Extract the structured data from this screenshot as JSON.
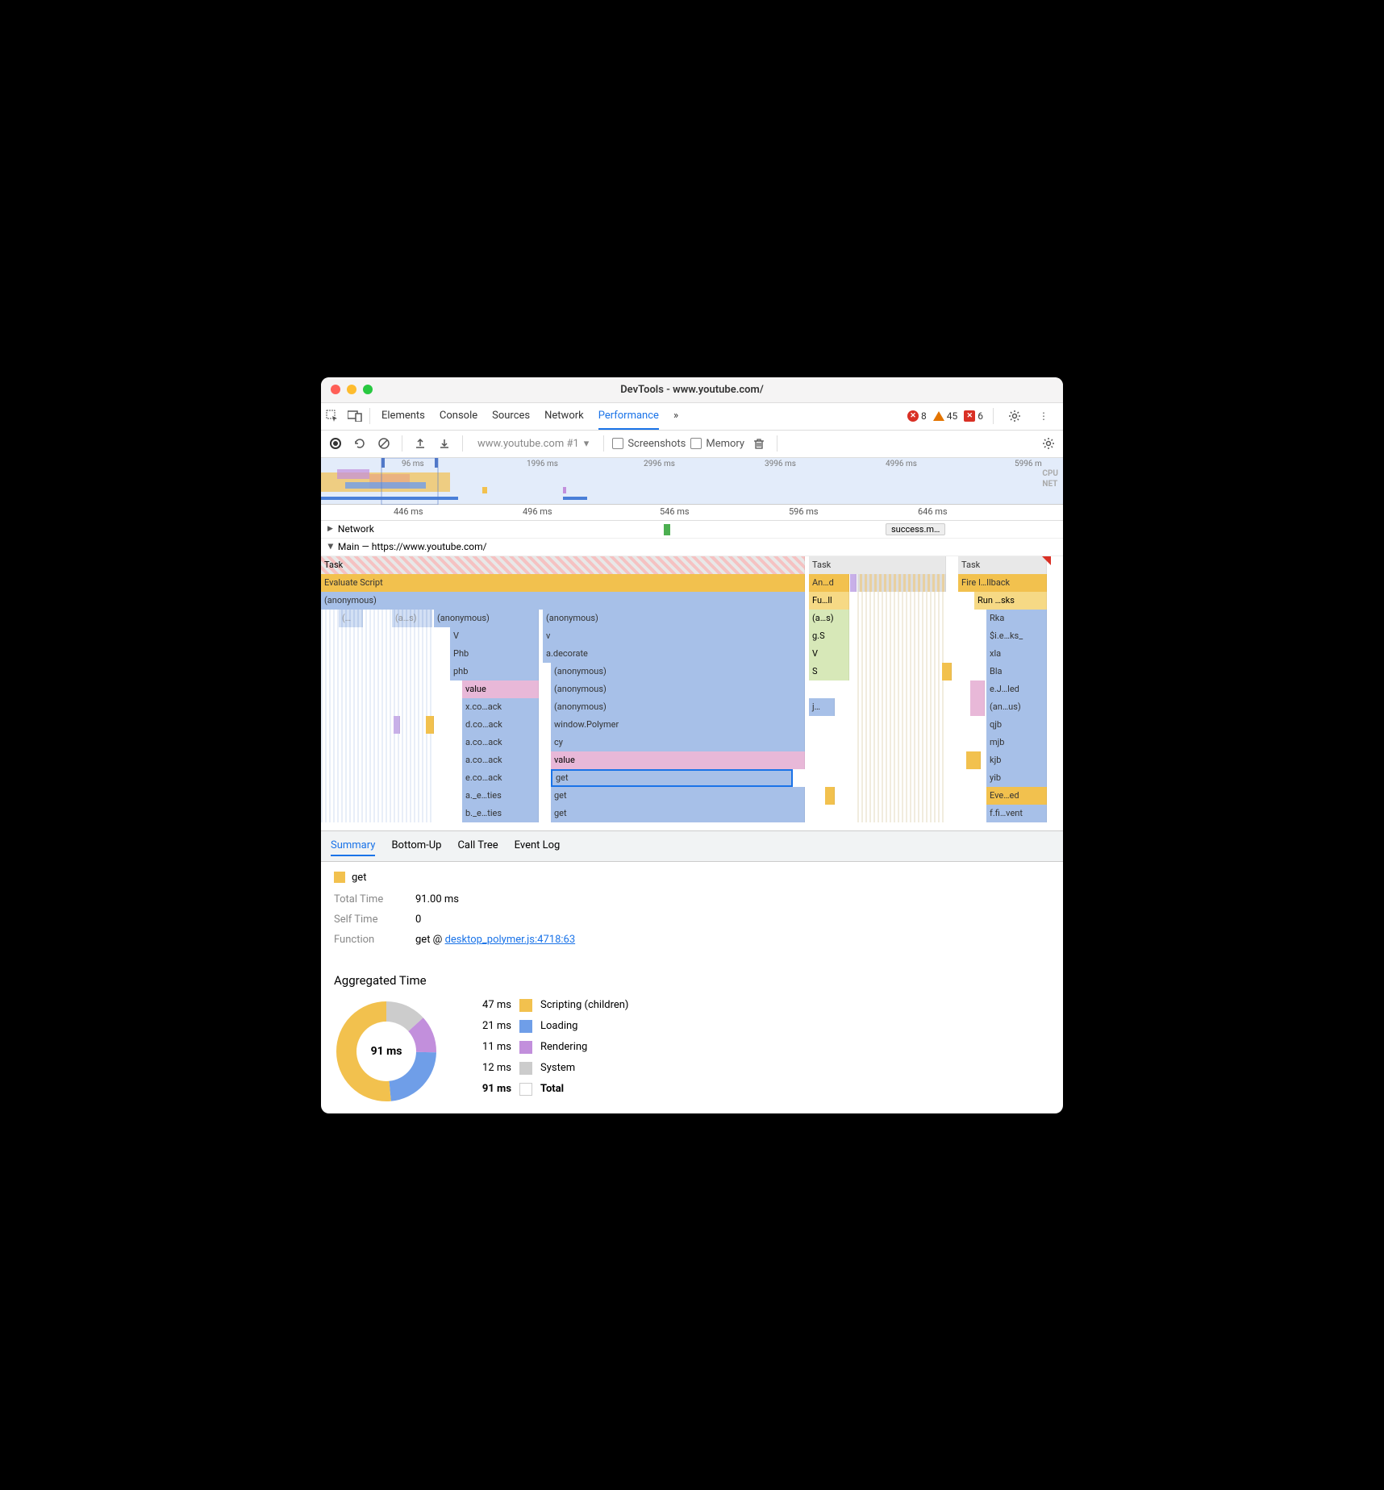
{
  "window": {
    "title": "DevTools - www.youtube.com/"
  },
  "mainTabs": {
    "elements": "Elements",
    "console": "Console",
    "sources": "Sources",
    "network": "Network",
    "performance": "Performance"
  },
  "statusBadges": {
    "errors": "8",
    "warnings": "45",
    "contentErrors": "6"
  },
  "perfToolbar": {
    "url": "www.youtube.com #1",
    "screenshots": "Screenshots",
    "memory": "Memory"
  },
  "overview": {
    "ticks": [
      "96 ms",
      "1996 ms",
      "2996 ms",
      "3996 ms",
      "4996 ms",
      "5996 m"
    ],
    "cpuLabel": "CPU",
    "netLabel": "NET"
  },
  "ruler": [
    "446 ms",
    "496 ms",
    "546 ms",
    "596 ms",
    "646 ms"
  ],
  "networkRow": {
    "label": "Network",
    "pill": "success.m…"
  },
  "mainRow": "Main — https://www.youtube.com/",
  "flameCol1": {
    "task": "Task",
    "evalScript": "Evaluate Script",
    "anon": "(anonymous)",
    "r3a": "(…",
    "r3b": "(a…s)",
    "r3c": "(anonymous)",
    "r4": "V",
    "r5": "Phb",
    "r6": "phb",
    "r7": "value",
    "r8": "x.co…ack",
    "r9": "d.co…ack",
    "r10": "a.co…ack",
    "r11": "a.co…ack",
    "r12": "e.co…ack",
    "r13": "a._e…ties",
    "r14": "b._e…ties"
  },
  "flameCol2": {
    "r3": "(anonymous)",
    "r4": "v",
    "r5": "a.decorate",
    "r6": "(anonymous)",
    "r7": "(anonymous)",
    "r8": "(anonymous)",
    "r9": "window.Polymer",
    "r10": "cy",
    "r11": "value",
    "r12": "get",
    "r13": "get",
    "r14": "get"
  },
  "flameCol3": {
    "task": "Task",
    "r1": "An…d",
    "r2": "Fu…ll",
    "r3": "(a…s)",
    "r4": "g.S",
    "r5": "V",
    "r6": "S",
    "r8": "j…"
  },
  "flameCol4": {
    "task": "Task",
    "r1": "Fire I…llback",
    "r2": "Run …sks",
    "r3": "Rka",
    "r4": "$i.e…ks_",
    "r5": "xla",
    "r6": "Bla",
    "r7": "e.J…led",
    "r8": "(an…us)",
    "r9": "qjb",
    "r10": "mjb",
    "r11": "kjb",
    "r12": "yib",
    "r13": "Eve…ed",
    "r14": "f.fi…vent"
  },
  "detailTabs": {
    "summary": "Summary",
    "bottomUp": "Bottom-Up",
    "callTree": "Call Tree",
    "eventLog": "Event Log"
  },
  "summary": {
    "name": "get",
    "totalTimeLabel": "Total Time",
    "totalTime": "91.00 ms",
    "selfTimeLabel": "Self Time",
    "selfTime": "0",
    "functionLabel": "Function",
    "functionText": "get @ ",
    "functionLink": "desktop_polymer.js:4718:63"
  },
  "aggregated": {
    "title": "Aggregated Time",
    "center": "91 ms",
    "rows": [
      {
        "ms": "47 ms",
        "label": "Scripting (children)",
        "sw": "sw-scripting"
      },
      {
        "ms": "21 ms",
        "label": "Loading",
        "sw": "sw-loading"
      },
      {
        "ms": "11 ms",
        "label": "Rendering",
        "sw": "sw-rendering"
      },
      {
        "ms": "12 ms",
        "label": "System",
        "sw": "sw-system"
      },
      {
        "ms": "91 ms",
        "label": "Total",
        "sw": "sw-total",
        "bold": true
      }
    ]
  },
  "chart_data": {
    "type": "pie",
    "title": "Aggregated Time",
    "series": [
      {
        "name": "Scripting (children)",
        "value": 47,
        "color": "#f2c14e"
      },
      {
        "name": "Loading",
        "value": 21,
        "color": "#6f9ee8"
      },
      {
        "name": "Rendering",
        "value": 11,
        "color": "#c28fdc"
      },
      {
        "name": "System",
        "value": 12,
        "color": "#cccccc"
      }
    ],
    "total": 91,
    "unit": "ms"
  }
}
